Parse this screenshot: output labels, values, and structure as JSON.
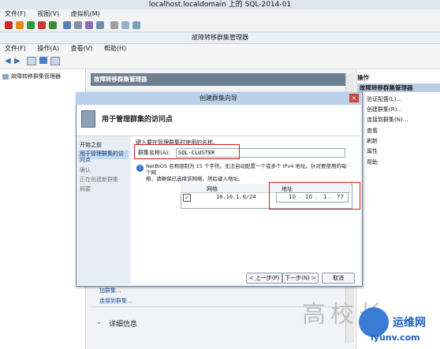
{
  "vm": {
    "title": "localhost.localdomain 上的 SQL-2014-01",
    "menu": [
      "文件(F)",
      "视图(V)",
      "虚拟机(M)"
    ]
  },
  "fcm": {
    "title": "故障转移群集管理器",
    "menu": [
      "文件(F)",
      "操作(A)",
      "查看(V)",
      "帮助(H)"
    ],
    "tree_item": "故障转移群集管理器",
    "center_header": "故障转移群集管理器",
    "center_links": [
      "加群集...",
      "连接到群集..."
    ],
    "details_label": "详细信息"
  },
  "actions": {
    "header": "操作",
    "section": "故障转移群集管理器",
    "items": [
      "验证配置(L)...",
      "创建群集(R)...",
      "连接到群集(N)...",
      "查看",
      "刷新",
      "属性",
      "帮助"
    ]
  },
  "dialog": {
    "title": "创建群集向导",
    "banner_title": "用于管理群集的访问点",
    "steps": [
      "开始之前",
      "用于管理群集的访问点",
      "确认",
      "正在创建新群集",
      "摘要"
    ],
    "instruction": "键入要在管理群集时使用的名称。",
    "name_label": "群集名称(A):",
    "name_value": "SQL-CLUSTER",
    "info_text_1": "NetBIOS 名称限制为 15 个字符。无法自动配置一个或多个 IPv4 地址。针对要使用的每个网",
    "info_text_2": "络，请确保已选择该网络，然后键入地址。",
    "table": {
      "col_network": "网络",
      "col_address": "地址",
      "row_network": "10.10.1.0/24",
      "ip": [
        "10",
        "10",
        "1",
        "77"
      ]
    },
    "buttons": {
      "prev": "< 上一步(P)",
      "next": "下一步(N) >",
      "cancel": "取消"
    }
  },
  "watermark": {
    "text": "高校长",
    "site_name": "运维网",
    "site_url": "iyunv.com"
  }
}
